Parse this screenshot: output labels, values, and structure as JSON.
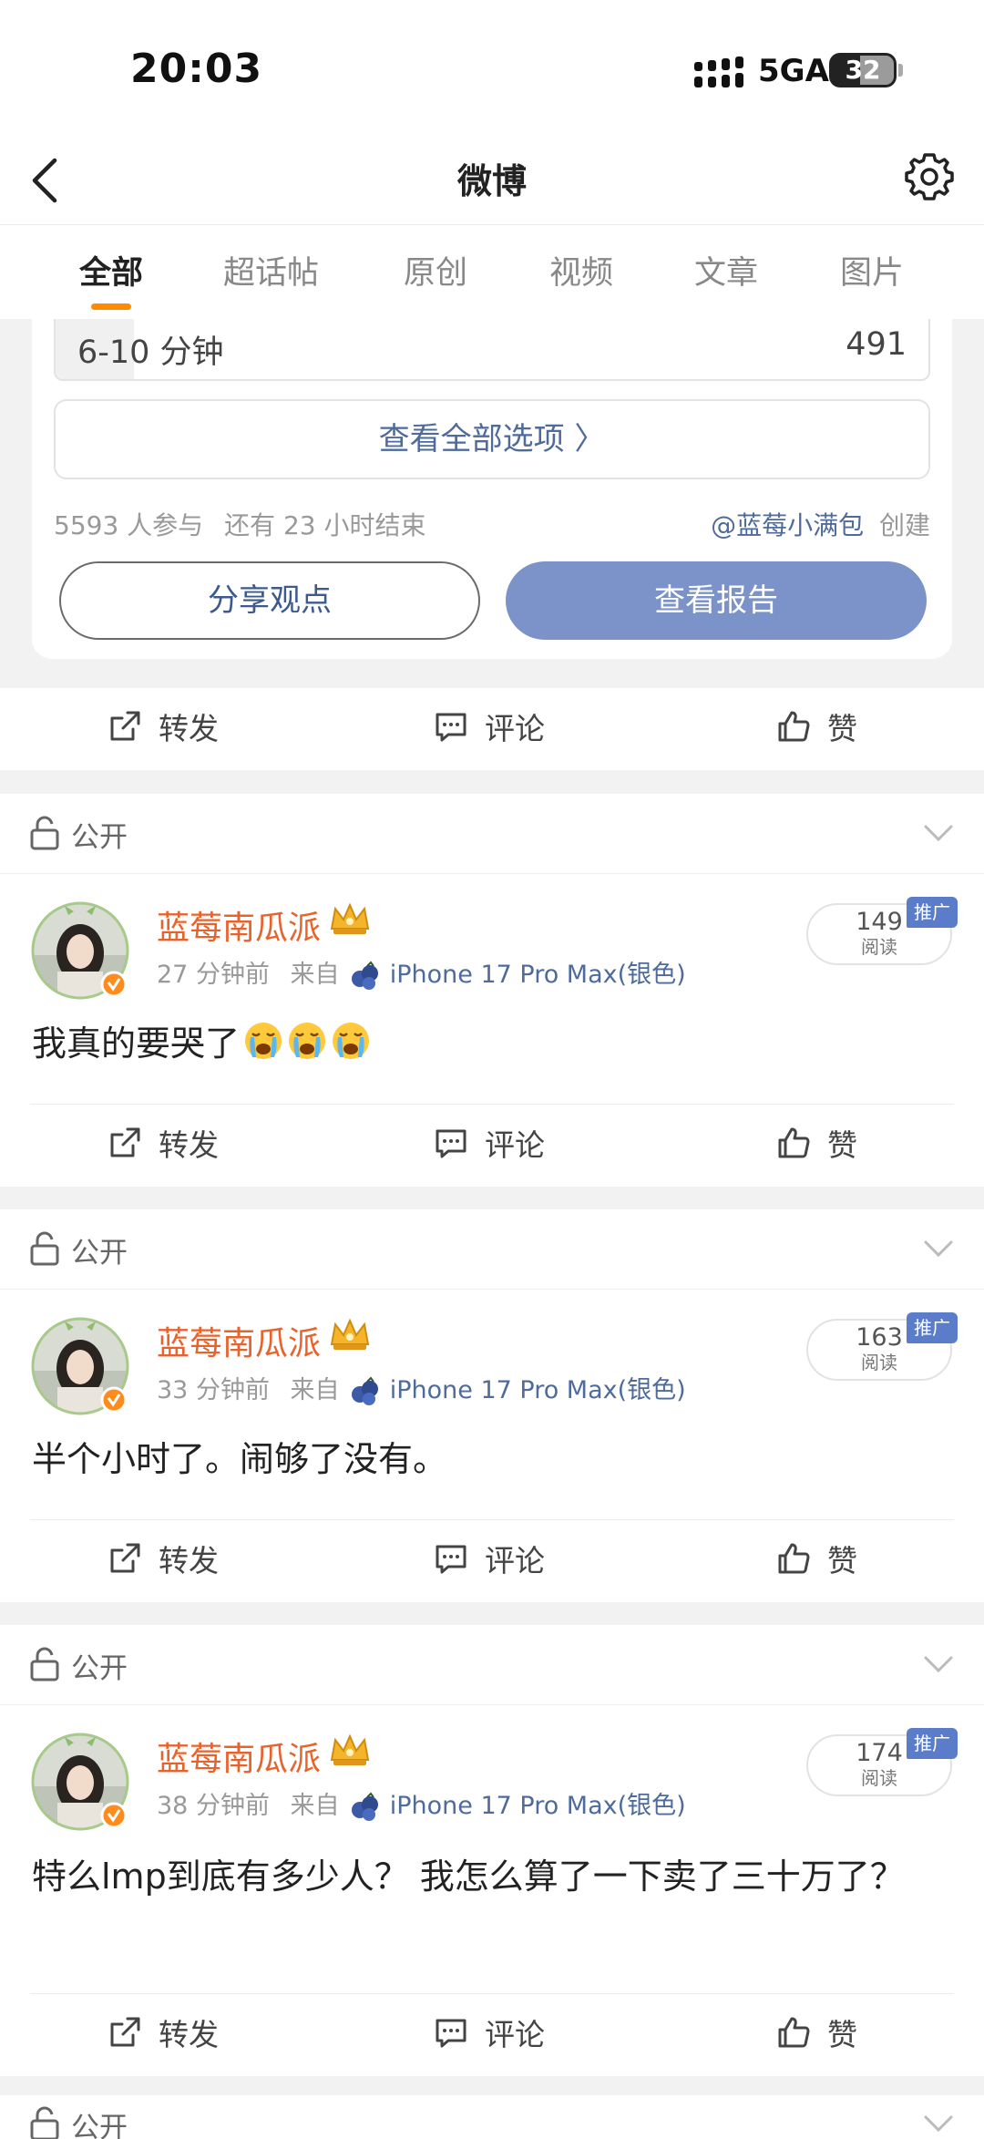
{
  "status_bar": {
    "time": "20:03",
    "network": "5GA",
    "battery": "32"
  },
  "header": {
    "title": "微博"
  },
  "tabs": [
    {
      "label": "全部",
      "active": true
    },
    {
      "label": "超话帖",
      "active": false
    },
    {
      "label": "原创",
      "active": false
    },
    {
      "label": "视频",
      "active": false
    },
    {
      "label": "文章",
      "active": false
    },
    {
      "label": "图片",
      "active": false
    }
  ],
  "poll": {
    "option": {
      "label": "6-10 分钟",
      "count": "491"
    },
    "view_all": "查看全部选项 〉",
    "participants": "5593 人参与",
    "time_left": "还有 23 小时结束",
    "creator_user": "@蓝莓小满包",
    "creator_suffix": "创建",
    "share_button": "分享观点",
    "report_button": "查看报告"
  },
  "actions": {
    "repost": "转发",
    "comment": "评论",
    "like": "赞"
  },
  "posts": [
    {
      "visibility": "公开",
      "author": "蓝莓南瓜派",
      "time": "27 分钟前",
      "source_prefix": "来自",
      "device": "iPhone 17 Pro Max(银色)",
      "reads": "149",
      "reads_label": "阅读",
      "promo_label": "推广",
      "text": "我真的要哭了",
      "emoji_count": 3
    },
    {
      "visibility": "公开",
      "author": "蓝莓南瓜派",
      "time": "33 分钟前",
      "source_prefix": "来自",
      "device": "iPhone 17 Pro Max(银色)",
      "reads": "163",
      "reads_label": "阅读",
      "promo_label": "推广",
      "text": "半个小时了。闹够了没有。"
    },
    {
      "visibility": "公开",
      "author": "蓝莓南瓜派",
      "time": "38 分钟前",
      "source_prefix": "来自",
      "device": "iPhone 17 Pro Max(银色)",
      "reads": "174",
      "reads_label": "阅读",
      "promo_label": "推广",
      "text": "特么lmp到底有多少人？ 我怎么算了一下卖了三十万了？"
    },
    {
      "visibility": "公开"
    }
  ],
  "colors": {
    "accent": "#ff8a00",
    "author": "#e8632c",
    "link": "#4e6b9c",
    "report_button": "#7b93c8",
    "promo": "#5b7cc9"
  },
  "icons": [
    "back-arrow-icon",
    "gear-icon",
    "repost-icon",
    "comment-icon",
    "like-icon",
    "lock-icon",
    "chevron-down-icon",
    "crown-icon",
    "blueberry-icon",
    "crying-emoji-icon"
  ]
}
